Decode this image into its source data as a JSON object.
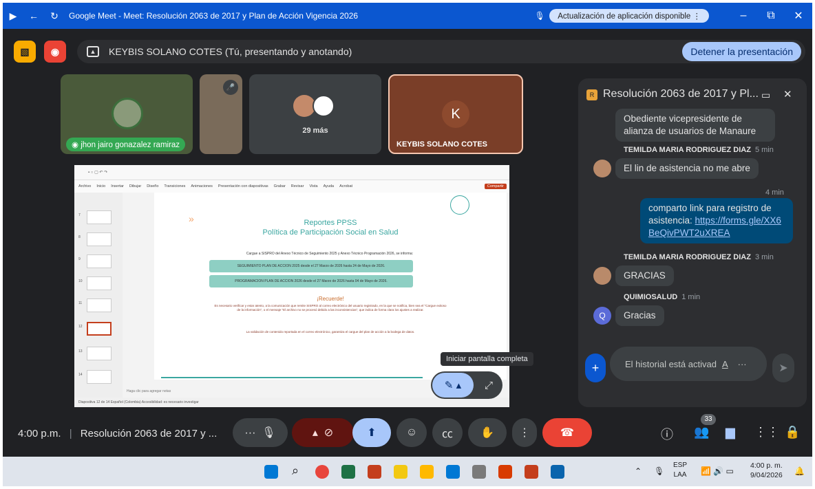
{
  "browser": {
    "title": "Google Meet - Meet: Resolución 2063 de 2017 y Plan de Acción Vigencia 2026",
    "update_label": "Actualización de aplicación disponible",
    "minimize": "–",
    "restore": "⧉",
    "close": "✕"
  },
  "presenting": {
    "text": "KEYBIS SOLANO COTES (Tú, presentando y anotando)",
    "stop_label": "Detener la presentación"
  },
  "tiles": {
    "jhon_name": "jhon jairo gonazalez ramiraz",
    "more_label": "29 más",
    "keybis_initial": "K",
    "keybis_name": "KEYBIS SOLANO COTES"
  },
  "slide": {
    "title1": "Reportes PPSS",
    "title2": "Política de Participación Social en Salud",
    "intro": "Cargue a SISPRO del Anexo Técnico de Seguimiento 2025 y Anexo Técnico Programación 2026, se informa:",
    "box1": "SEGUIMIENTO PLAN DE ACCION 2025 desde el 27 Marzo de 2026 hasta 24 de Mayo de 2026.",
    "box2": "PROGRAMACION PLAN DE ACCION 2026 desde el 27 Marzo de 2026 hasta 04 de Mayo de 2026.",
    "recuerde": "¡Recuerde!",
    "body": "Es necesario verificar y estar atento, a la comunicación que remite SISPRO al correo electrónico del usuario registrado, en la que se notifica, bien sea el \"Cargue exitoso de la información\", o el mensaje \"El archivo no se procesó debido a las inconsistencias\", que indica de forma clara los ajustes a realizar.",
    "validacion": "La validación de contenido reportada en el correo electrónico, garantiza el cargue del plan de acción a la bodega de datos.",
    "notes_hint": "Haga clic para agregar notas",
    "status": "Diapositiva 12 de 14   Español (Colombia)   Accesibilidad: es necesario investigar",
    "menu": [
      "Archivo",
      "Inicio",
      "Insertar",
      "Dibujar",
      "Diseño",
      "Transiciones",
      "Animaciones",
      "Presentación con diapositivas",
      "Grabar",
      "Revisar",
      "Vista",
      "Ayuda",
      "Acrobat"
    ],
    "share": "Compartir",
    "thumb_numbers": [
      "7",
      "8",
      "9",
      "10",
      "11",
      "12",
      "13",
      "14"
    ]
  },
  "tooltip": "Iniciar pantalla completa",
  "chat": {
    "title": "Resolución 2063 de 2017 y Pl...",
    "prev_msg": "Obediente vicepresidente de alianza de usuarios de Manaure",
    "messages": [
      {
        "sender": "TEMILDA MARIA RODRIGUEZ DIAZ",
        "time": "5 min",
        "text": "El lin de asistencia no me abre"
      },
      {
        "time": "4 min",
        "text": "comparto link para registro de asistencia: ",
        "link": "https://forms.gle/XX6BeQivPWT2uXREA"
      },
      {
        "sender": "TEMILDA MARIA RODRIGUEZ DIAZ",
        "time": "3 min",
        "text": "GRACIAS"
      },
      {
        "sender": "QUIMIOSALUD",
        "time": "1 min",
        "text": "Gracias",
        "initial": "Q"
      }
    ],
    "input_placeholder": "El historial está activad",
    "add_icon": "+",
    "send_icon": "➤"
  },
  "bottom": {
    "time": "4:00 p.m.",
    "meeting": "Resolución 2063 de 2017 y ...",
    "participants_count": "33"
  },
  "taskbar": {
    "lang": "ESP",
    "region": "LAA",
    "time": "4:00 p. m.",
    "date": "9/04/2026"
  },
  "colors": {
    "accent": "#0b57d0",
    "end_call": "#ea4335",
    "present": "#a8c7fa",
    "chat_self": "#004a77"
  }
}
